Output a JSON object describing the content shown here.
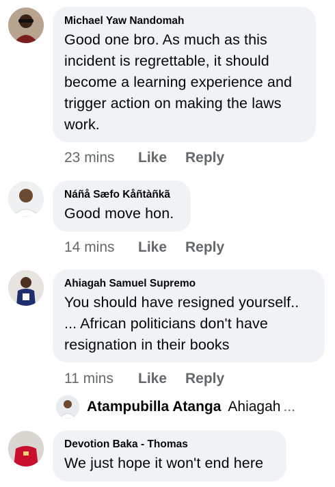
{
  "comments": [
    {
      "author": "Michael Yaw Nandomah",
      "text": "Good one bro. As much as this incident is regrettable, it should become a learning experience and trigger action on making the laws work.",
      "time": "23 mins",
      "like_label": "Like",
      "reply_label": "Reply"
    },
    {
      "author": "Náñå Sæfo Kåñtàñkã",
      "text": "Good move hon.",
      "time": "14 mins",
      "like_label": "Like",
      "reply_label": "Reply"
    },
    {
      "author": "Ahiagah Samuel Supremo",
      "text": "You should have resigned yourself.. ... African politicians don't have resignation in their books",
      "time": "11 mins",
      "like_label": "Like",
      "reply_label": "Reply"
    },
    {
      "author": "Devotion Baka - Thomas",
      "text": "We just hope it won't end here"
    }
  ],
  "reply_preview": {
    "author": "Atampubilla Atanga",
    "text": "Ahiagah",
    "ellipsis": "..."
  },
  "colors": {
    "bubble_bg": "#f0f2f5",
    "meta_text": "#65676b",
    "primary_text": "#050505"
  }
}
